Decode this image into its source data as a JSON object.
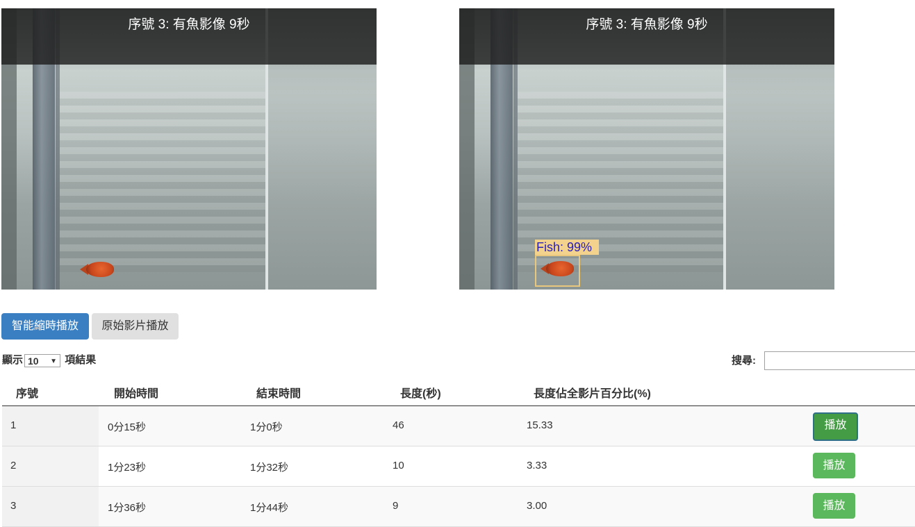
{
  "videos": {
    "left": {
      "title": "序號 3: 有魚影像 9秒"
    },
    "right": {
      "title": "序號 3: 有魚影像 9秒",
      "detection_label": "Fish: 99%"
    }
  },
  "buttons": {
    "smart_play": "智能縮時播放",
    "original_play": "原始影片播放"
  },
  "length_control": {
    "prefix": "顯示",
    "value": "10",
    "suffix": "項結果"
  },
  "search": {
    "label": "搜尋:",
    "value": ""
  },
  "table": {
    "headers": [
      "序號",
      "開始時間",
      "結束時間",
      "長度(秒)",
      "長度佔全影片百分比(%)"
    ],
    "rows": [
      {
        "id": "1",
        "start": "0分15秒",
        "end": "1分0秒",
        "length": "46",
        "percent": "15.33",
        "action": "播放"
      },
      {
        "id": "2",
        "start": "1分23秒",
        "end": "1分32秒",
        "length": "10",
        "percent": "3.33",
        "action": "播放"
      },
      {
        "id": "3",
        "start": "1分36秒",
        "end": "1分44秒",
        "length": "9",
        "percent": "3.00",
        "action": "播放"
      }
    ]
  },
  "colors": {
    "primary": "#3a7fc1",
    "success": "#5cb85c",
    "bbox": "#f3d28e"
  }
}
